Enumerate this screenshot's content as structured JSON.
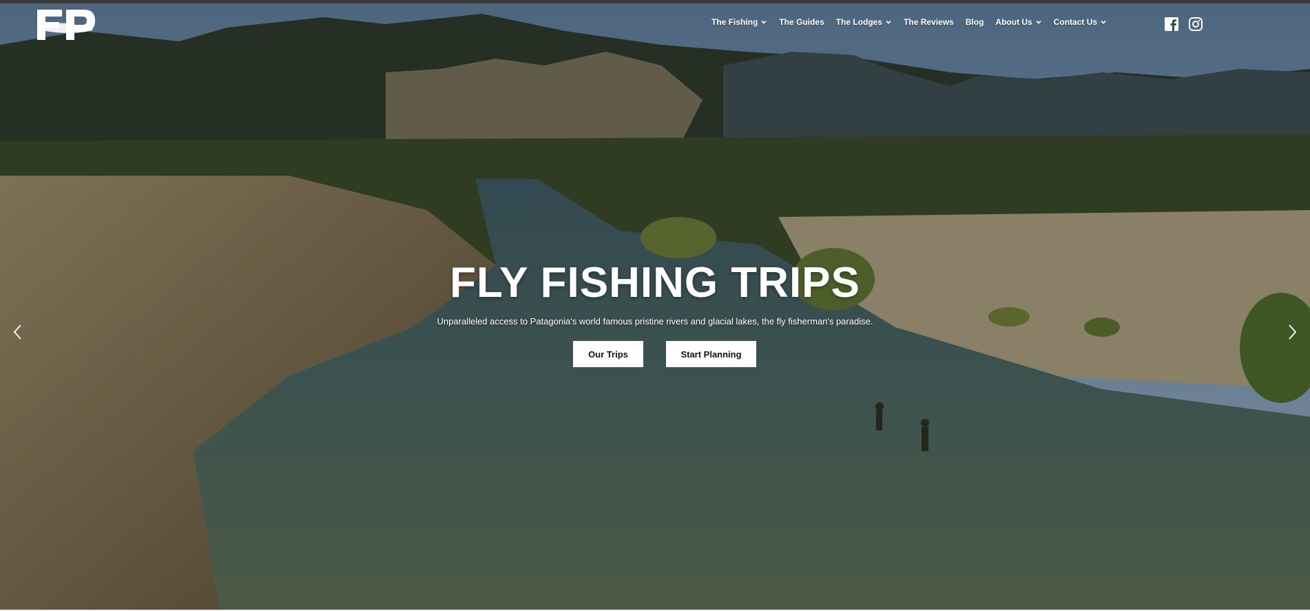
{
  "brand": {
    "logo_text": "FP"
  },
  "nav": {
    "items": [
      {
        "label": "The Fishing",
        "has_dropdown": true
      },
      {
        "label": "The Guides",
        "has_dropdown": false
      },
      {
        "label": "The Lodges",
        "has_dropdown": true
      },
      {
        "label": "The Reviews",
        "has_dropdown": false
      },
      {
        "label": "Blog",
        "has_dropdown": false
      },
      {
        "label": "About Us",
        "has_dropdown": true
      },
      {
        "label": "Contact Us",
        "has_dropdown": true
      }
    ]
  },
  "social": {
    "icons": [
      "facebook-icon",
      "instagram-icon"
    ]
  },
  "hero": {
    "title": "FLY FISHING TRIPS",
    "subtitle": "Unparalleled access to Patagonia's world famous pristine rivers and glacial lakes, the fly fisherman's paradise.",
    "buttons": {
      "primary": "Our Trips",
      "secondary": "Start Planning"
    },
    "prev_icon": "chevron-left-icon",
    "next_icon": "chevron-right-icon"
  },
  "colors": {
    "text": "#ffffff",
    "button_bg": "#ffffff",
    "button_text": "#111111",
    "top_bar": "#3a3a3a"
  }
}
